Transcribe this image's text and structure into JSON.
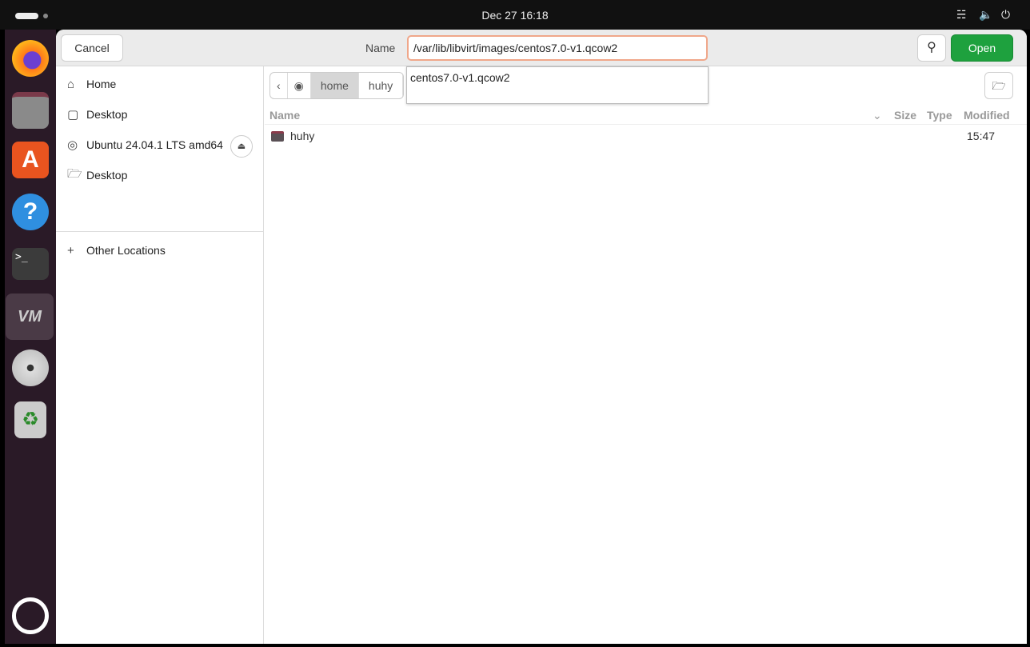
{
  "topbar": {
    "clock": "Dec 27  16:18",
    "tray_icons": [
      "network-icon",
      "volume-icon",
      "power-icon"
    ]
  },
  "dock": {
    "apps": [
      "firefox",
      "files",
      "app-center",
      "help",
      "terminal",
      "virt-manager",
      "disc",
      "trash",
      "show-apps"
    ]
  },
  "header": {
    "cancel_label": "Cancel",
    "name_label": "Name",
    "name_value": "/var/lib/libvirt/images/centos7.0-v1.qcow2",
    "open_label": "Open"
  },
  "autocomplete": {
    "items": [
      "centos7.0-v1.qcow2"
    ]
  },
  "sidebar": {
    "items": [
      {
        "label": "Home",
        "icon": "home-icon"
      },
      {
        "label": "Desktop",
        "icon": "desktop-icon"
      },
      {
        "label": "Ubuntu 24.04.1 LTS amd64",
        "icon": "disc-icon"
      },
      {
        "label": "Desktop",
        "icon": "folder-icon"
      }
    ],
    "other": "Other Locations"
  },
  "pathbar": {
    "segments": [
      "home",
      "huhy"
    ]
  },
  "columns": {
    "name": "Name",
    "size": "Size",
    "type": "Type",
    "modified": "Modified"
  },
  "files": [
    {
      "name": "huhy",
      "size": "",
      "type": "",
      "modified": "15:47"
    }
  ],
  "colors": {
    "accent": "#1ea13e",
    "focus": "#f0a78a",
    "dock": "#2a1a27"
  }
}
